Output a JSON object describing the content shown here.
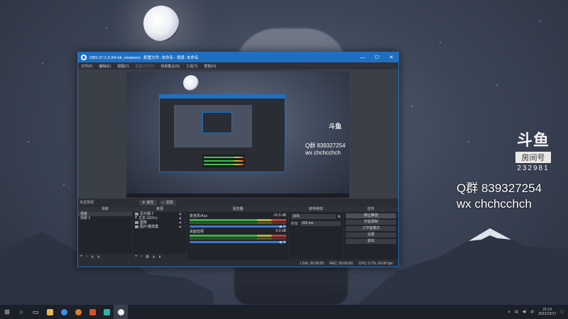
{
  "overlay": {
    "line1": "Q群 839327254",
    "line2": "wx chchcchch"
  },
  "douyu": {
    "logo": "斗鱼",
    "room_label": "房间号",
    "room_number": "232981"
  },
  "obs": {
    "title": "OBS 27.1.3 (64-bit, windows) - 配置文件: 未命名 - 场景: 未命名",
    "window_buttons": [
      "—",
      "☐",
      "✕"
    ],
    "menu": [
      "文件(F)",
      "编辑(E)",
      "视图(V)",
      "配置文件(P)",
      "场景集合(S)",
      "工具(T)",
      "帮助(H)"
    ],
    "source_bar": {
      "no_selection": "未选择源",
      "properties": "属性",
      "filters": "滤镜"
    },
    "scenes": {
      "header": "场景",
      "items": [
        "场景",
        "场景 2"
      ],
      "selected": 0
    },
    "sources": {
      "header": "来源",
      "items": [
        {
          "name": "显示器 2",
          "icon": "monitor-icon"
        },
        {
          "name": "文本 (GDI+)",
          "icon": "text-icon"
        },
        {
          "name": "图像",
          "icon": "image-icon"
        },
        {
          "name": "图片/播放集",
          "icon": "slideshow-icon"
        }
      ]
    },
    "mixer": {
      "header": "混音器",
      "tracks": [
        {
          "name": "麦克风/Aux",
          "db": "-10.5 dB"
        },
        {
          "name": "桌面音频",
          "db": "0.0 dB"
        }
      ]
    },
    "transitions": {
      "header": "转场特效",
      "type": "淡出",
      "duration_label": "时长",
      "duration_value": "300 ms"
    },
    "controls": {
      "header": "控件",
      "buttons": [
        "停止推流",
        "开始录制",
        "工作室模式",
        "设置",
        "退出"
      ]
    },
    "status": {
      "live_label": "LIVE:",
      "live_time": "00:00:00",
      "rec_label": "REC:",
      "rec_time": "00:00:00",
      "cpu": "CPU: 0.7%, 60.00 fps"
    },
    "preview": {
      "text1": "Q群 839327254",
      "text2": "wx chchcchch",
      "douyu": "斗鱼"
    }
  },
  "taskbar": {
    "start_icon": "windows-icon",
    "clock_time": "21:14",
    "clock_date": "2021/12/17"
  }
}
